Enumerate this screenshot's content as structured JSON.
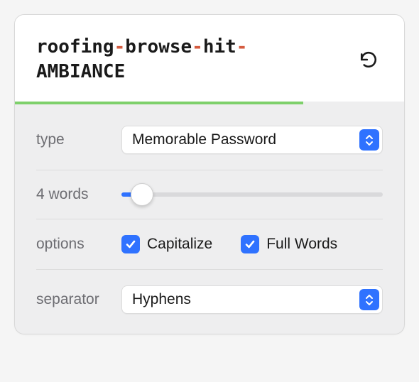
{
  "password": {
    "parts": [
      "roofing",
      "browse",
      "hit",
      "AMBIANCE"
    ],
    "separator_glyph": "-"
  },
  "settings": {
    "type": {
      "label": "type",
      "value": "Memorable Password"
    },
    "words": {
      "count_label": "4 words",
      "slider_value_percent": 8
    },
    "options": {
      "label": "options",
      "capitalize": {
        "label": "Capitalize",
        "checked": true
      },
      "full_words": {
        "label": "Full Words",
        "checked": true
      }
    },
    "separator": {
      "label": "separator",
      "value": "Hyphens"
    }
  }
}
